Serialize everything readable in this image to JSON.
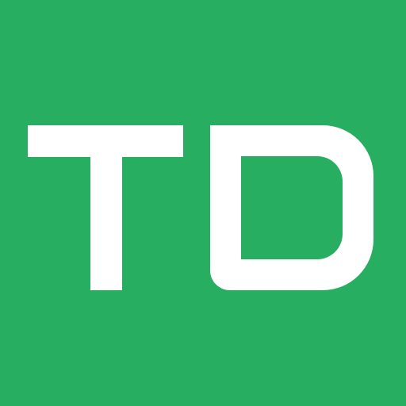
{
  "logo": {
    "text": "TD",
    "background_color": "#27AE60",
    "foreground_color": "#FFFFFF"
  }
}
